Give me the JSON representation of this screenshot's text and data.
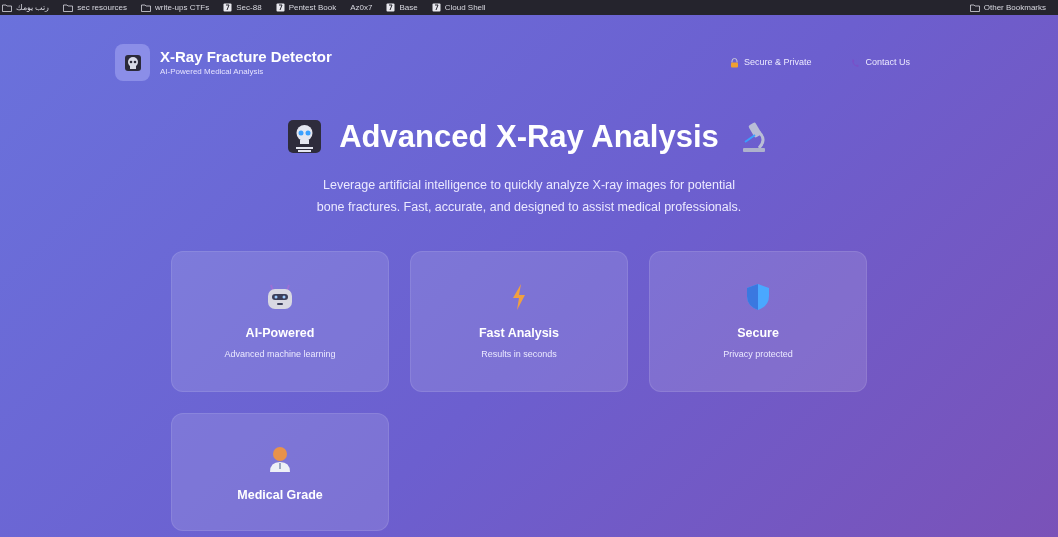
{
  "bookmarks_bar": {
    "items": [
      {
        "label": "رتب يومك",
        "kind": "folder"
      },
      {
        "label": "sec resources",
        "kind": "folder"
      },
      {
        "label": "write-ups CTFs",
        "kind": "folder"
      },
      {
        "label": "Sec-88",
        "kind": "site"
      },
      {
        "label": "Pentest Book",
        "kind": "site"
      },
      {
        "label": "Az0x7",
        "kind": "plain"
      },
      {
        "label": "Base",
        "kind": "site"
      },
      {
        "label": "Cloud Shell",
        "kind": "site"
      }
    ],
    "other": {
      "label": "Other Bookmarks"
    }
  },
  "header": {
    "title": "X-Ray Fracture Detector",
    "subtitle": "AI-Powered Medical Analysis",
    "nav": [
      {
        "label": "Secure & Private",
        "kind": "lock"
      },
      {
        "label": "Contact Us",
        "kind": "phone"
      }
    ]
  },
  "hero": {
    "title": "Advanced X-Ray Analysis",
    "description": "Leverage artificial intelligence to quickly analyze X-ray images for potential bone fractures. Fast, accurate, and designed to assist medical professionals."
  },
  "features": [
    {
      "title": "AI-Powered",
      "description": "Advanced machine learning",
      "kind": "robot"
    },
    {
      "title": "Fast Analysis",
      "description": "Results in seconds",
      "kind": "bolt"
    },
    {
      "title": "Secure",
      "description": "Privacy protected",
      "kind": "shield"
    },
    {
      "title": "Medical Grade",
      "kind": "doctor"
    }
  ]
}
